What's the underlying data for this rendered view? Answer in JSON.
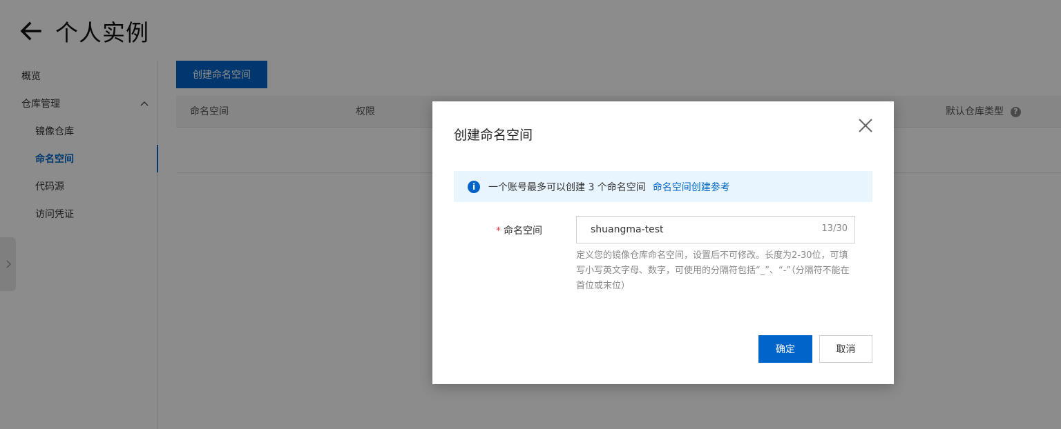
{
  "page": {
    "title": "个人实例"
  },
  "sidebar": {
    "items": [
      {
        "label": "概览"
      },
      {
        "label": "仓库管理"
      },
      {
        "label": "镜像仓库"
      },
      {
        "label": "命名空间"
      },
      {
        "label": "代码源"
      },
      {
        "label": "访问凭证"
      }
    ]
  },
  "main": {
    "create_button": "创建命名空间",
    "table": {
      "columns": [
        "命名空间",
        "权限",
        "默认仓库类型"
      ]
    }
  },
  "modal": {
    "title": "创建命名空间",
    "notice": {
      "text": "一个账号最多可以创建 3 个命名空间",
      "link": "命名空间创建参考"
    },
    "field": {
      "required_mark": "*",
      "label": "命名空间",
      "value": "shuangma-test",
      "count": "13/30",
      "help": "定义您的镜像仓库命名空间，设置后不可修改。长度为2-30位，可填写小写英文字母、数字，可使用的分隔符包括“_”、“-”（分隔符不能在首位或末位）"
    },
    "ok_button": "确定",
    "cancel_button": "取消"
  },
  "colors": {
    "primary": "#0064c8",
    "notice_bg": "#e9f5fe",
    "required": "#e4393c"
  }
}
